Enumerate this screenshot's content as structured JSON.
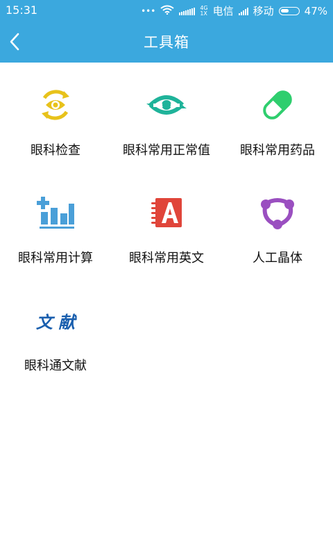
{
  "status_bar": {
    "time": "15:31",
    "dots": "•••",
    "network_type_top": "4G",
    "network_type_bottom": "1X",
    "carrier1": "电信",
    "carrier2": "移动",
    "battery": "47%"
  },
  "app_bar": {
    "title": "工具箱"
  },
  "tools": [
    {
      "label": "眼科检查",
      "icon": "eye-check-icon",
      "color": "#e8c21a"
    },
    {
      "label": "眼科常用正常值",
      "icon": "eye-normal-value-icon",
      "color": "#1fb39a"
    },
    {
      "label": "眼科常用药品",
      "icon": "pill-icon",
      "color": "#2fce6e"
    },
    {
      "label": "眼科常用计算",
      "icon": "calculation-chart-icon",
      "color": "#4a9fd8"
    },
    {
      "label": "眼科常用英文",
      "icon": "english-book-icon",
      "color": "#e0453a"
    },
    {
      "label": "人工晶体",
      "icon": "intraocular-lens-icon",
      "color": "#9a4fc0"
    },
    {
      "label": "眼科通文献",
      "icon": "literature-icon",
      "color": "#1a5fae",
      "icon_text": "文 献"
    }
  ]
}
